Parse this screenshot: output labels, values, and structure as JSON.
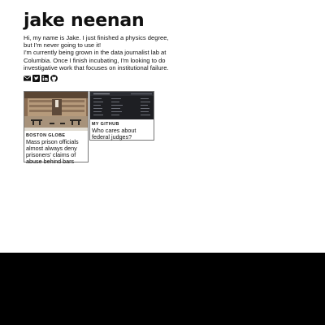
{
  "profile": {
    "name": "jake neenan",
    "bio_line_1": "Hi, my name is Jake. I just finished a physics degree, but I'm never going to use it!",
    "bio_line_2": "I'm currently being grown in the data journalist lab at Columbia. Once I finish incubating, I'm looking to do investigative work that focuses on institutional failure."
  },
  "social_icons": [
    "email-icon",
    "twitter-icon",
    "linkedin-icon",
    "github-icon"
  ],
  "cards": [
    {
      "source": "BOSTON GLOBE",
      "title": "Mass prison officials almost always deny prisoners' claims of abuse behind bars"
    },
    {
      "source": "MY GITHUB",
      "title": "Who cares about federal judges?"
    }
  ],
  "colors": {
    "background": "#ffffff",
    "text": "#111111",
    "card_border": "#777777",
    "footer_band": "#000000"
  }
}
